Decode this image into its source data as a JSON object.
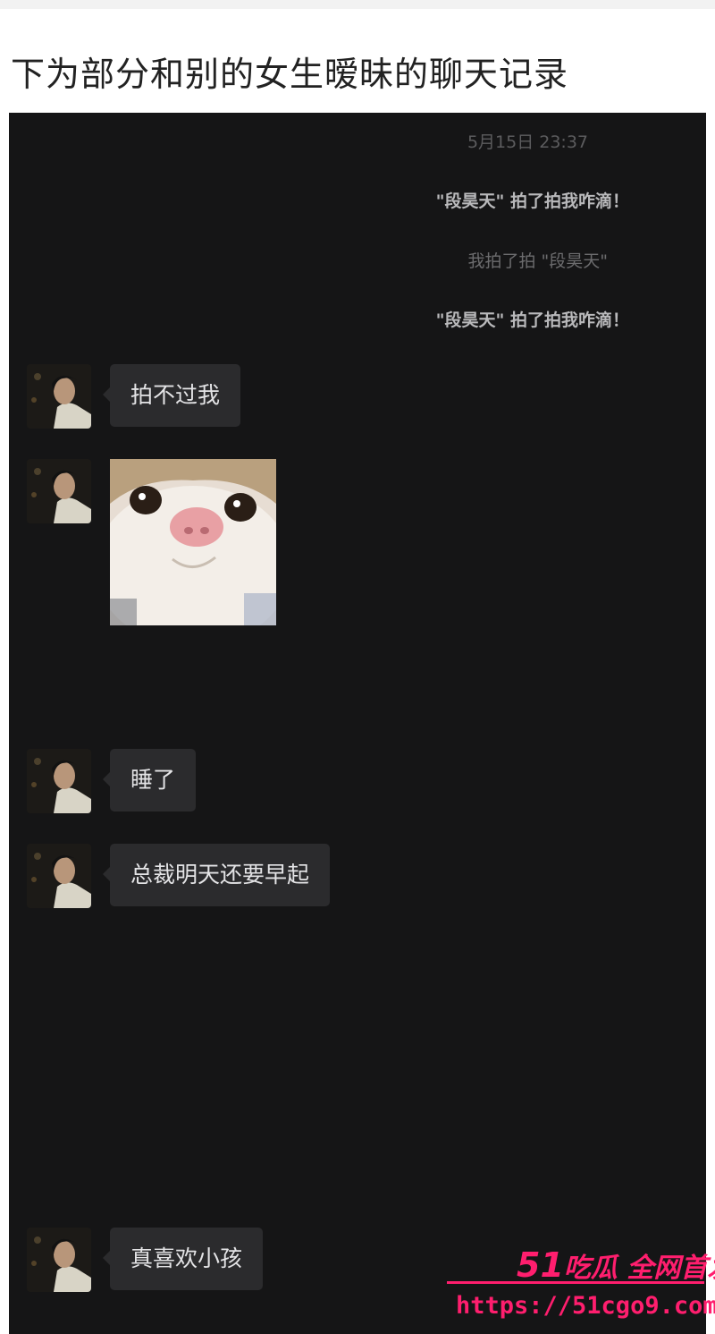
{
  "caption": "下为部分和别的女生暧昧的聊天记录",
  "system_messages": {
    "timestamp": "5月15日 23:37",
    "pat_1": "\"段昊天\" 拍了拍我咋滴！",
    "pat_2": "我拍了拍 \"段昊天\"",
    "pat_3": "\"段昊天\" 拍了拍我咋滴！"
  },
  "messages": [
    {
      "type": "text",
      "text": "拍不过我"
    },
    {
      "type": "sticker",
      "icon": "cat-face-sticker"
    },
    {
      "type": "text",
      "text": "睡了"
    },
    {
      "type": "text",
      "text": "总裁明天还要早起"
    },
    {
      "type": "text",
      "text": "真喜欢小孩"
    }
  ],
  "watermark": {
    "brand_number": "51",
    "brand_text": "吃瓜 全网首发",
    "url": "https://51cgo9.com",
    "color": "#ff1e6e"
  },
  "colors": {
    "chat_background": "#151516",
    "bubble_background": "#2b2b2d",
    "bubble_text": "#e4e4e6"
  }
}
